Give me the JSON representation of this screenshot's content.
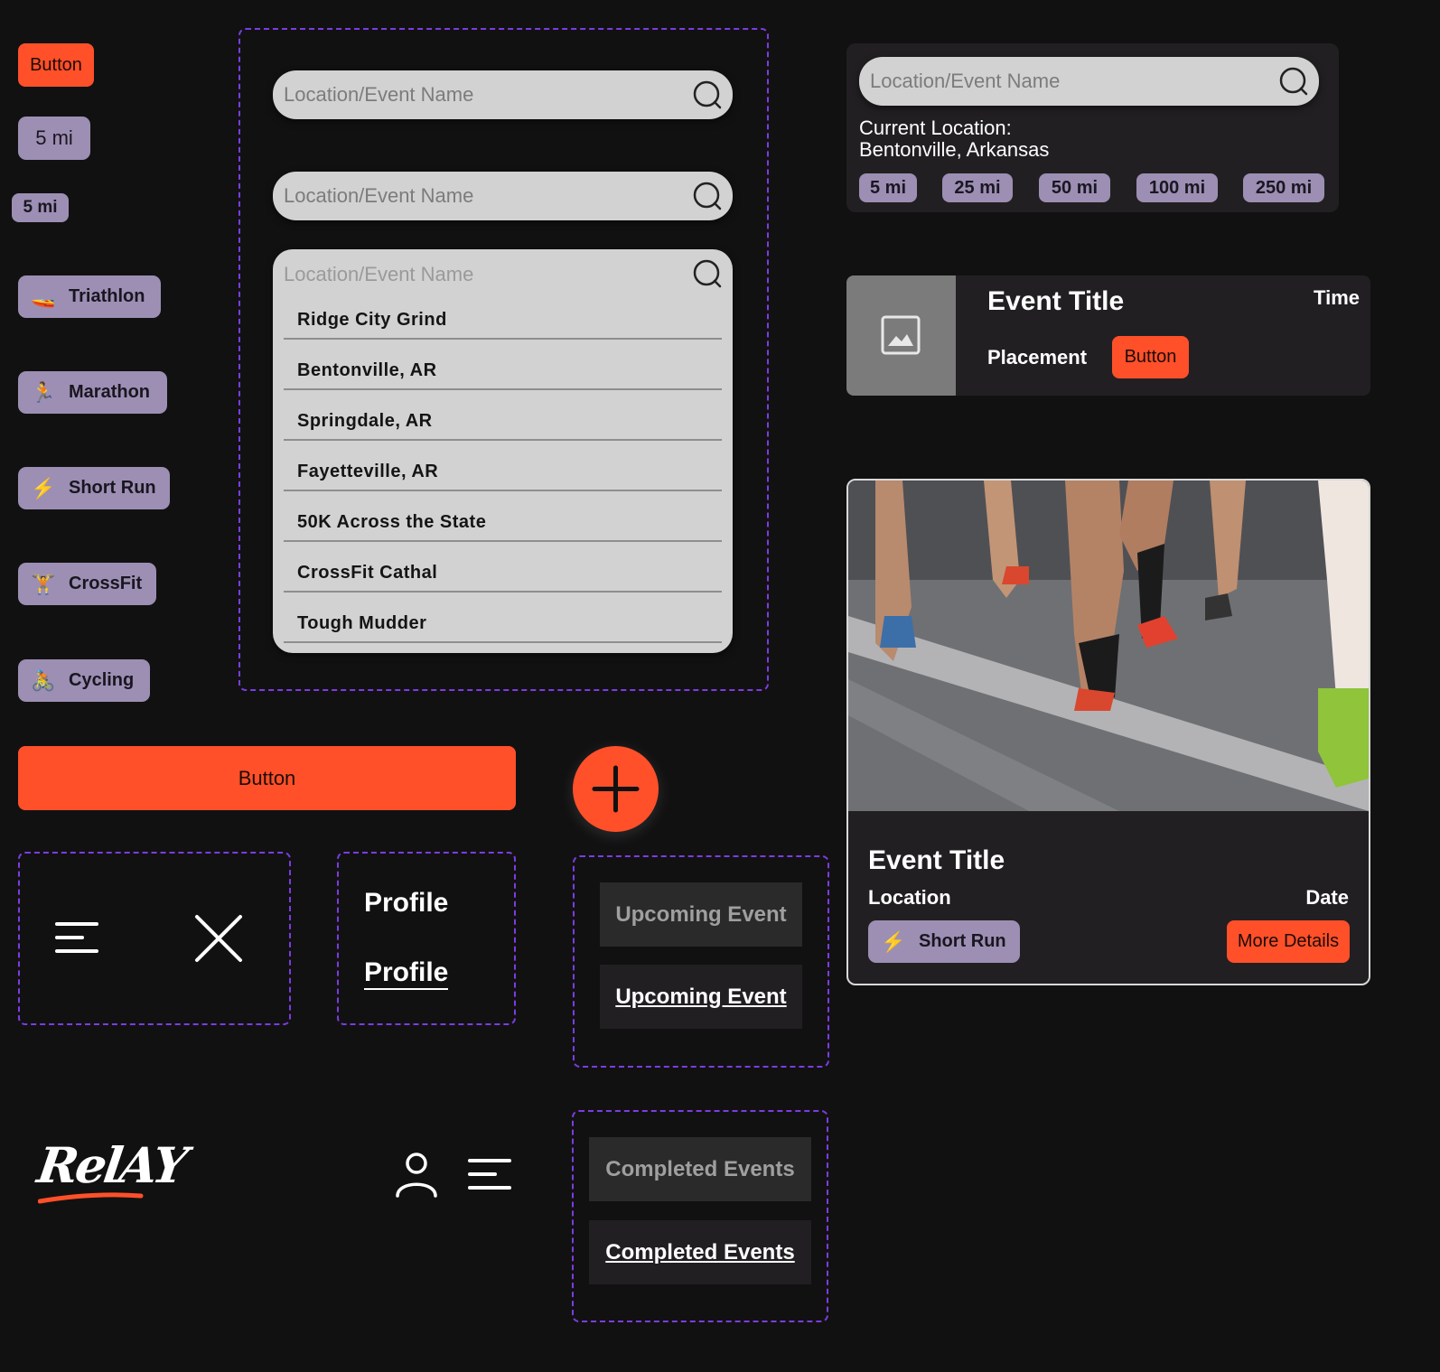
{
  "buttons": {
    "small": "Button",
    "wide": "Button",
    "card_button": "Button",
    "more_details": "More Details"
  },
  "distance_chips": {
    "large": "5 mi",
    "small": "5 mi"
  },
  "categories": [
    {
      "label": "Triathlon",
      "icon": "🚤",
      "name": "triathlon-icon"
    },
    {
      "label": "Marathon",
      "icon": "🏃",
      "name": "runner-icon"
    },
    {
      "label": "Short Run",
      "icon": "⚡",
      "name": "lightning-icon"
    },
    {
      "label": "CrossFit",
      "icon": "🏋",
      "name": "weightlifter-icon"
    },
    {
      "label": "Cycling",
      "icon": "🚴",
      "name": "cyclist-icon"
    }
  ],
  "search": {
    "placeholder": "Location/Event Name",
    "dropdown_items": [
      "Ridge City Grind",
      "Bentonville, AR",
      "Springdale, AR",
      "Fayetteville, AR",
      "50K Across the State",
      "CrossFit Cathal",
      "Tough Mudder"
    ]
  },
  "location_panel": {
    "placeholder": "Location/Event Name",
    "current_location_label": "Current Location:",
    "current_location_value": "Bentonville, Arkansas",
    "distances": [
      "5 mi",
      "25 mi",
      "50 mi",
      "100 mi",
      "250 mi"
    ]
  },
  "result_card": {
    "title": "Event Title",
    "time": "Time",
    "placement": "Placement",
    "button": "Button"
  },
  "event_card": {
    "title": "Event Title",
    "location": "Location",
    "date": "Date",
    "tag": "Short Run",
    "tag_icon": "⚡",
    "button": "More Details"
  },
  "profile": {
    "default": "Profile",
    "active": "Profile"
  },
  "tabs": {
    "upcoming_default": "Upcoming Event",
    "upcoming_active": "Upcoming Event",
    "completed_default": "Completed Events",
    "completed_active": "Completed Events"
  },
  "logo": {
    "text": "RelAY"
  },
  "colors": {
    "background": "#121112",
    "accent": "#ff5029",
    "chip": "#9c8fb3",
    "card": "#221f22",
    "search": "#d2d2d2",
    "dashed_frame": "#7a3de3"
  }
}
